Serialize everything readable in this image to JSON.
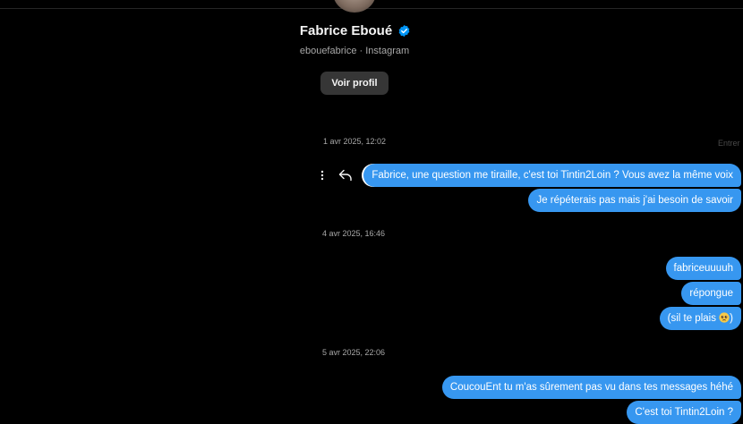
{
  "profile": {
    "name": "Fabrice Eboué",
    "handle": "ebouefabrice · Instagram",
    "view_profile_label": "Voir profil"
  },
  "header_cut_text": "Entrer",
  "groups": [
    {
      "timestamp": "1 avr 2025, 12:02",
      "messages": [
        "Fabrice, une question me tiraille, c'est toi Tintin2Loin ? Vous avez la même voix",
        "Je répéterais pas mais j'ai besoin de savoir"
      ]
    },
    {
      "timestamp": "4 avr 2025, 16:46",
      "messages": [
        "fabriceuuuuh",
        "répongue",
        "(sil te plais ",
        ")"
      ]
    },
    {
      "timestamp": "5 avr 2025, 22:06",
      "messages": [
        "CoucouEnt tu m'as sûrement pas vu dans tes messages héhé",
        "C'est toi Tintin2Loin ?"
      ]
    }
  ],
  "icons": {
    "verified": "verified-badge-icon",
    "more": "more-options-icon",
    "reply": "reply-arrow-icon",
    "emoji": "pleading-face-emoji"
  },
  "colors": {
    "background": "#000000",
    "bubble": "#3797f0",
    "verified": "#0095f6",
    "button": "#363636",
    "muted_text": "#a8a8a8"
  }
}
